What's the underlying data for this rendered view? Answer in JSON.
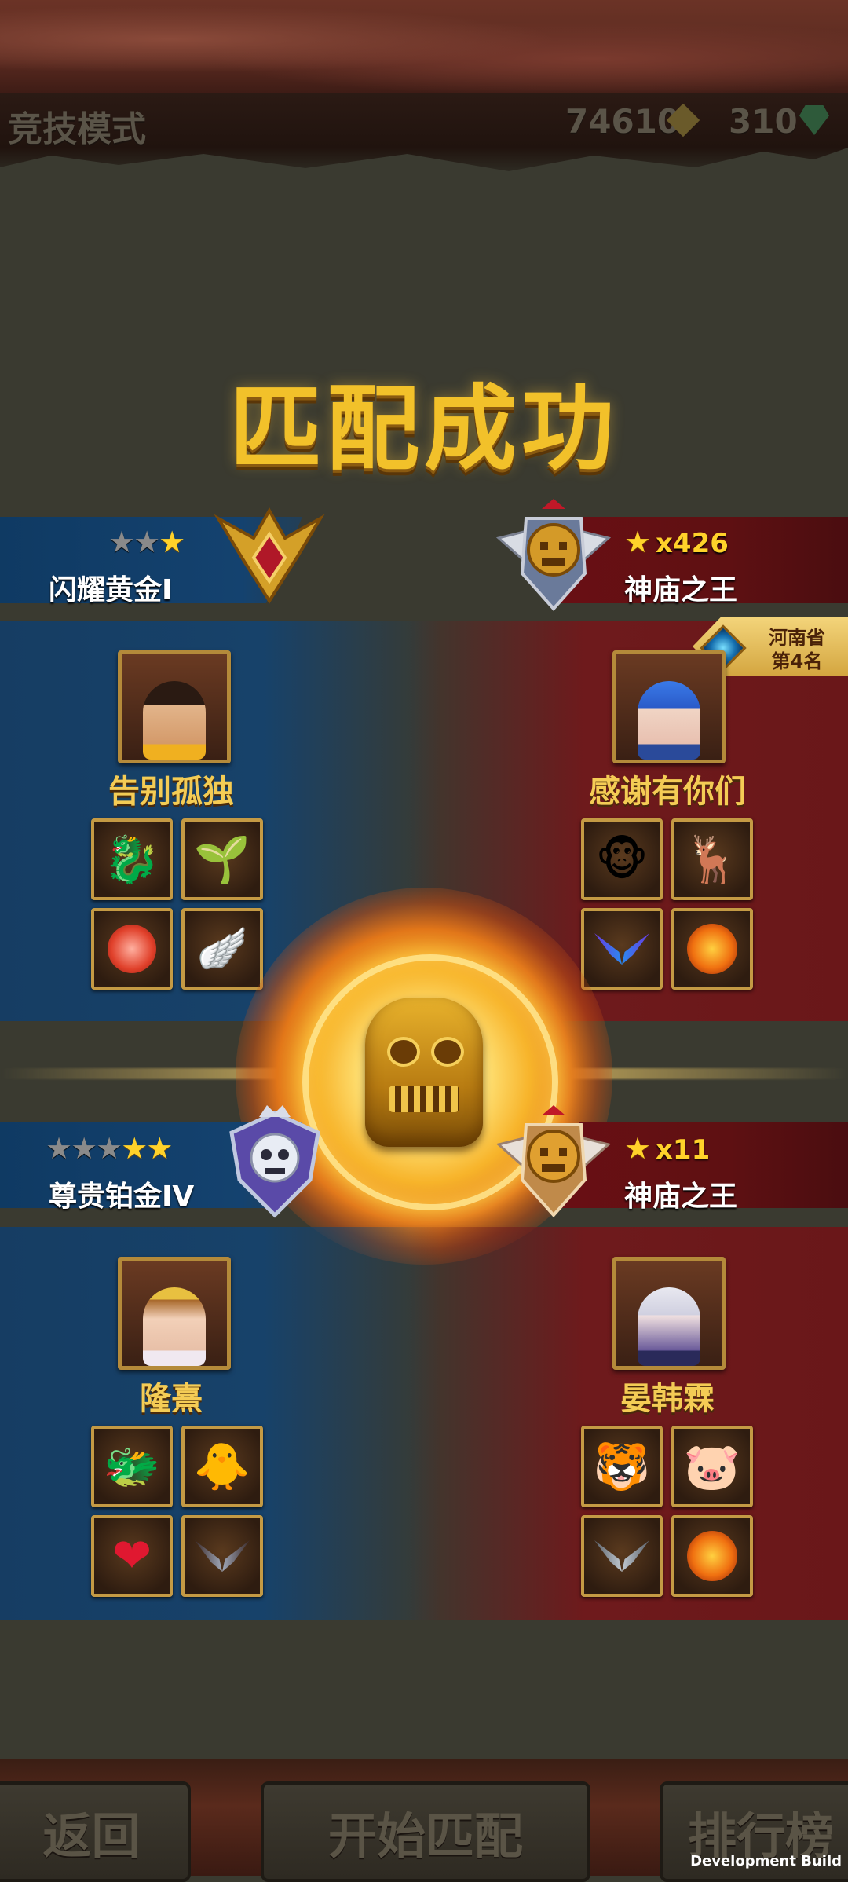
{
  "header": {
    "mode_title": "竞技模式",
    "coins": "74610",
    "gems": "310"
  },
  "title": "匹配成功",
  "match1": {
    "left": {
      "rank_name": "闪耀黄金I",
      "stars_filled": 1,
      "stars_total": 3,
      "player_name": "告别孤独",
      "slots": [
        "dragon-mount-icon",
        "plant-pet-icon",
        "pink-orb-icon",
        "silver-wings-icon"
      ]
    },
    "right": {
      "rank_name": "神庙之王",
      "star_count": "x426",
      "player_name": "感谢有你们",
      "province_line1": "河南省",
      "province_line2": "第4名",
      "slots": [
        "monkey-pet-icon",
        "white-deer-icon",
        "purple-wings-icon",
        "fire-lion-orb-icon"
      ]
    }
  },
  "match2": {
    "left": {
      "rank_name": "尊贵铂金IV",
      "stars_filled": 2,
      "stars_total": 5,
      "player_name": "隆熹",
      "slots": [
        "red-dragon-mount-icon",
        "golden-pet-icon",
        "red-heart-orb-icon",
        "dark-wings-icon"
      ]
    },
    "right": {
      "rank_name": "神庙之王",
      "star_count": "x11",
      "player_name": "晏韩霖",
      "slots": [
        "tiger-pet-icon",
        "pink-pet-icon",
        "gray-wings-icon",
        "fire-lion-orb-icon"
      ]
    }
  },
  "buttons": {
    "back": "返回",
    "start_match": "开始匹配",
    "leaderboard": "排行榜"
  },
  "footer": {
    "build_label": "Development Build"
  },
  "colors": {
    "team_blue": "#163d63",
    "team_red": "#6e1a1c",
    "gold_text": "#f4cc55",
    "title_gold": "#f2c12a"
  }
}
